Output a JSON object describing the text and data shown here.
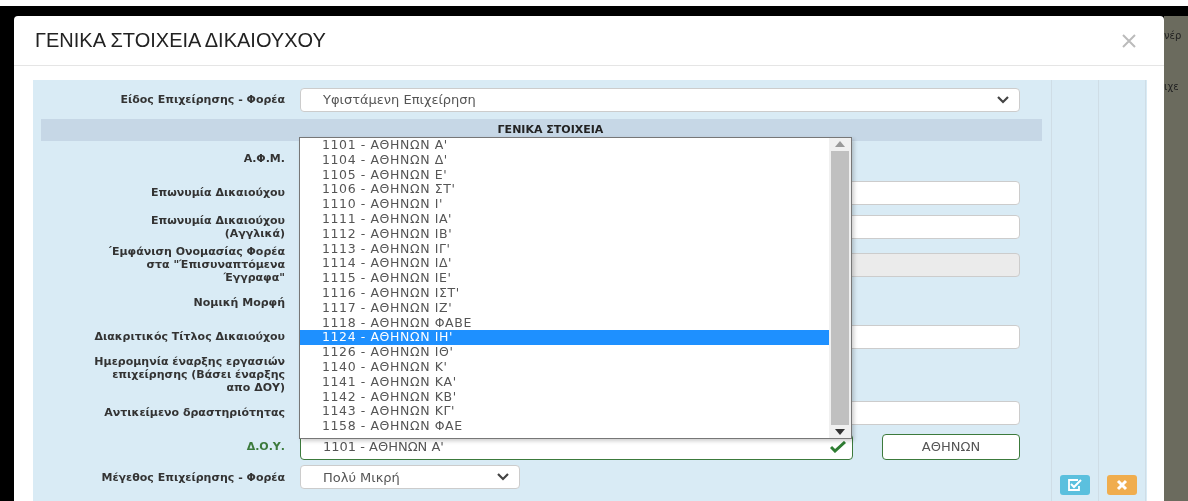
{
  "background_fragments": [
    "νέρ",
    "ιχε"
  ],
  "dialog": {
    "title": "ΓΕΝΙΚΑ ΣΤΟΙΧΕΙΑ ΔΙΚΑΙΟΥΧΟΥ"
  },
  "business_type": {
    "label": "Είδος Επιχείρησης - Φορέα",
    "value": "Υφιστάμενη Επιχείρηση"
  },
  "section_title": "ΓΕΝΙΚΑ ΣΤΟΙΧΕΙΑ",
  "fields": [
    {
      "label_lines": [
        "Α.Φ.Μ."
      ],
      "kind": "covered"
    },
    {
      "label_lines": [
        "Επωνυμία Δικαιούχου"
      ],
      "kind": "text"
    },
    {
      "label_lines": [
        "Επωνυμία Δικαιούχου",
        "(Αγγλικά)"
      ],
      "kind": "text"
    },
    {
      "label_lines": [
        "΄Εμφάνιση Ονομασίας Φορέα",
        "στα \"Έπισυναπτόμενα",
        "Έγγραφα\""
      ],
      "kind": "disabled"
    },
    {
      "label_lines": [
        "Νομική Μορφή"
      ],
      "kind": "covered"
    },
    {
      "label_lines": [
        "Διακριτικός Τίτλος Δικαιούχου"
      ],
      "kind": "text"
    },
    {
      "label_lines": [
        "Ημερομηνία έναρξης εργασιών",
        "επιχείρησης (Βάσει έναρξης",
        "απο ΔΟΥ)"
      ],
      "kind": "covered"
    },
    {
      "label_lines": [
        "Αντικείμενο δραστηριότητας"
      ],
      "kind": "text"
    },
    {
      "label_lines": [
        "Δ.Ο.Υ."
      ],
      "kind": "tax_office",
      "value": "1101 - ΑΘΗΝΩΝ Α'",
      "valid": true,
      "city": "ΑΘΗΝΩΝ"
    },
    {
      "label_lines": [
        "Μέγεθος Επιχείρησης - Φορέα"
      ],
      "kind": "select",
      "value": "Πολύ Μικρή"
    }
  ],
  "tax_office_list": [
    {
      "label": "1101 - ΑΘΗΝΩΝ Α'",
      "selected": false
    },
    {
      "label": "1104 - ΑΘΗΝΩΝ Δ'",
      "selected": false
    },
    {
      "label": "1105 - ΑΘΗΝΩΝ Ε'",
      "selected": false
    },
    {
      "label": "1106 - ΑΘΗΝΩΝ ΣΤ'",
      "selected": false
    },
    {
      "label": "1110 - ΑΘΗΝΩΝ Ι'",
      "selected": false
    },
    {
      "label": "1111 - ΑΘΗΝΩΝ ΙΑ'",
      "selected": false
    },
    {
      "label": "1112 - ΑΘΗΝΩΝ ΙΒ'",
      "selected": false
    },
    {
      "label": "1113 - ΑΘΗΝΩΝ ΙΓ'",
      "selected": false
    },
    {
      "label": "1114 - ΑΘΗΝΩΝ ΙΔ'",
      "selected": false
    },
    {
      "label": "1115 - ΑΘΗΝΩΝ ΙΕ'",
      "selected": false
    },
    {
      "label": "1116 - ΑΘΗΝΩΝ ΙΣΤ'",
      "selected": false
    },
    {
      "label": "1117 - ΑΘΗΝΩΝ ΙΖ'",
      "selected": false
    },
    {
      "label": "1118 - ΑΘΗΝΩΝ ΦΑΒΕ",
      "selected": false
    },
    {
      "label": "1124 - ΑΘΗΝΩΝ ΙΗ'",
      "selected": true
    },
    {
      "label": "1126 - ΑΘΗΝΩΝ ΙΘ'",
      "selected": false
    },
    {
      "label": "1140 - ΑΘΗΝΩΝ Κ'",
      "selected": false
    },
    {
      "label": "1141 - ΑΘΗΝΩΝ ΚΑ'",
      "selected": false
    },
    {
      "label": "1142 - ΑΘΗΝΩΝ ΚΒ'",
      "selected": false
    },
    {
      "label": "1143 - ΑΘΗΝΩΝ ΚΓ'",
      "selected": false
    },
    {
      "label": "1158 - ΑΘΗΝΩΝ ΦΑΕ",
      "selected": false
    }
  ],
  "actions": [
    {
      "kind": "confirm"
    },
    {
      "kind": "cancel"
    }
  ]
}
